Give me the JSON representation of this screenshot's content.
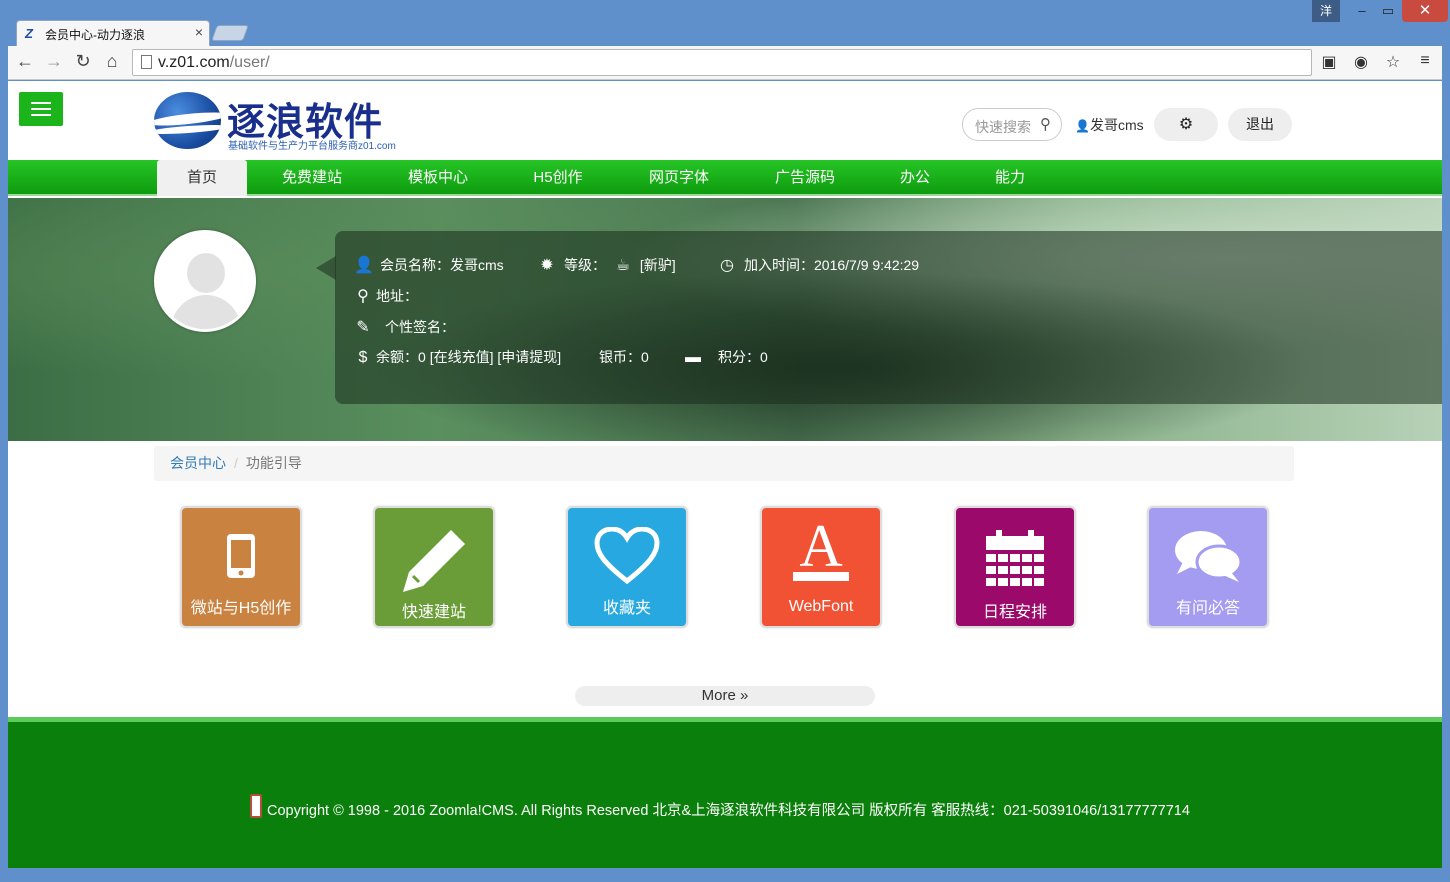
{
  "browser": {
    "tab_title": "会员中心-动力逐浪",
    "tab_logo": "Z",
    "window_user": "洋",
    "address_host": "v.z01.com",
    "address_path": "/user/"
  },
  "header": {
    "logo_name": "逐浪软件",
    "logo_tagline": "基础软件与生产力平台服务商z01.com",
    "search_placeholder": "快速搜索",
    "username": "发哥cms",
    "logout_label": "退出"
  },
  "nav": {
    "items": [
      "首页",
      "免费建站",
      "模板中心",
      "H5创作",
      "网页字体",
      "广告源码",
      "办公",
      "能力"
    ],
    "active_index": 0
  },
  "profile": {
    "member_name_label": "会员名称：发哥cms",
    "rank_label": "等级：",
    "rank_value": "[新驴]",
    "join_label": "加入时间：2016/7/9 9:42:29",
    "address_label": "地址：",
    "signature_label": "个性签名：",
    "balance_label": "余额：0",
    "recharge_link": "[在线充值]",
    "withdraw_link": "[申请提现]",
    "silver_label": "银币：0",
    "points_label": "积分：0"
  },
  "breadcrumb": {
    "root": "会员中心",
    "separator": "/",
    "current": "功能引导"
  },
  "tiles": [
    {
      "label": "微站与H5创作",
      "color": "#c98240",
      "icon": "mobile-icon"
    },
    {
      "label": "快速建站",
      "color": "#6a9d38",
      "icon": "pencil-icon"
    },
    {
      "label": "收藏夹",
      "color": "#28a8e0",
      "icon": "heart-icon"
    },
    {
      "label": "WebFont",
      "color": "#f05233",
      "icon": "font-a-icon"
    },
    {
      "label": "日程安排",
      "color": "#9b0a6b",
      "icon": "calendar-icon"
    },
    {
      "label": "有问必答",
      "color": "#a49cf0",
      "icon": "chat-icon"
    }
  ],
  "more_label": "More »",
  "footer": {
    "copyright": "Copyright © 1998 - 2016 Zoomla!CMS. All Rights Reserved 北京&上海逐浪软件科技有限公司 版权所有 客服热线：021-50391046/13177777714"
  }
}
